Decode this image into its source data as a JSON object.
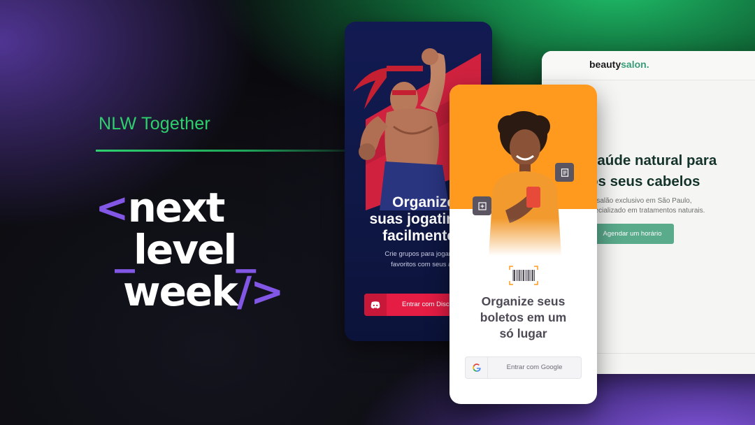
{
  "event": {
    "subtitle": "NLW Together",
    "logo": {
      "row1_bracket": "<",
      "row1_word": "next",
      "row2_prefix": "_",
      "row2_word": "level",
      "row2_suffix": "_",
      "row3_word": "week",
      "row3_suffix": "/>"
    }
  },
  "game_app": {
    "heading": [
      "Organize",
      "suas jogatin",
      "facilmente"
    ],
    "subtitle": [
      "Crie grupos para jogar seus g",
      "favoritos com seus amigo"
    ],
    "button_label": "Entrar com Disco",
    "button_icon": "discord-icon",
    "colors": {
      "background": "#121a52",
      "accent": "#e51c44"
    }
  },
  "salon_site": {
    "brand_part1": "beauty",
    "brand_part2": "salon.",
    "hero": [
      "saúde natural para",
      "os seus cabelos"
    ],
    "description": [
      "n salão exclusivo em São Paulo,",
      "pecializado em tratamentos naturais."
    ],
    "cta_label": "Agendar um horário",
    "colors": {
      "accent": "#5aaa8c",
      "heading": "#14332a"
    }
  },
  "boletos_app": {
    "title": [
      "Organize seus",
      "boletos em um",
      "só lugar"
    ],
    "button_label": "Entrar com Google",
    "button_icon": "google-icon",
    "tag_icons": [
      "document-icon",
      "add-box-icon"
    ],
    "colors": {
      "hero": "#ff9a1f",
      "title": "#4d4a56"
    }
  }
}
